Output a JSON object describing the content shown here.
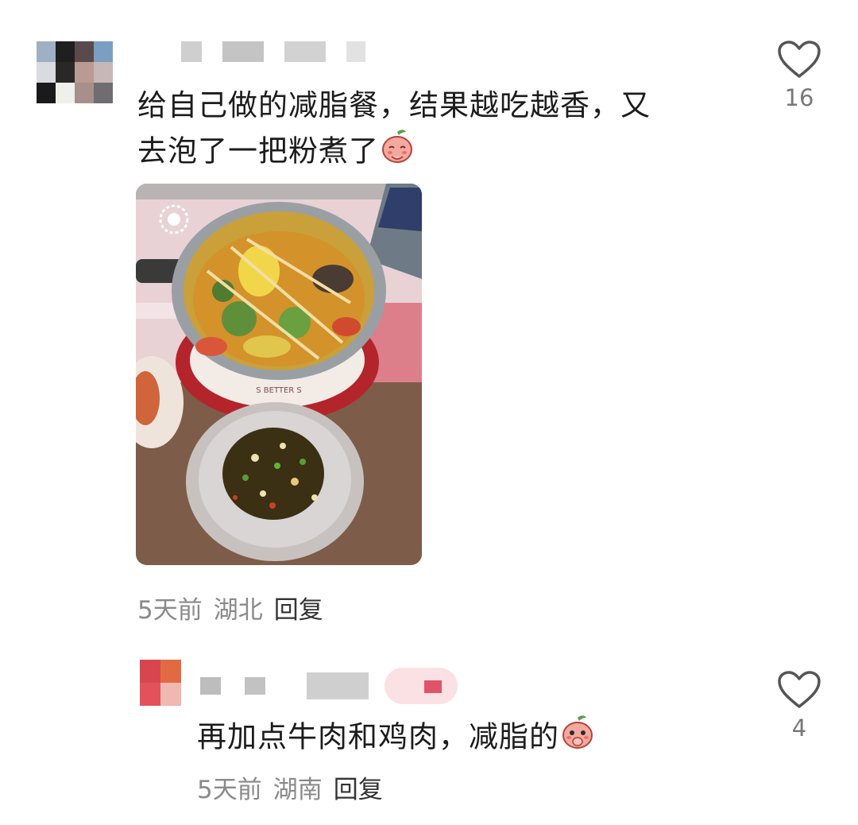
{
  "comments": [
    {
      "text_line1": "给自己做的减脂餐，结果越吃越香，又",
      "text_line2": "去泡了一把粉煮了",
      "emoji": "peach-smile-emoji",
      "time": "5天前",
      "location": "湖北",
      "reply_label": "回复",
      "likes": "16",
      "has_image": true
    },
    {
      "text": "再加点牛肉和鸡肉，减脂的",
      "emoji": "peach-shy-emoji",
      "time": "5天前",
      "location": "湖南",
      "reply_label": "回复",
      "likes": "4"
    }
  ],
  "icons": {
    "like": "heart-outline-icon"
  },
  "colors": {
    "meta_text": "#8a8a8a",
    "icon_stroke": "#555555"
  }
}
